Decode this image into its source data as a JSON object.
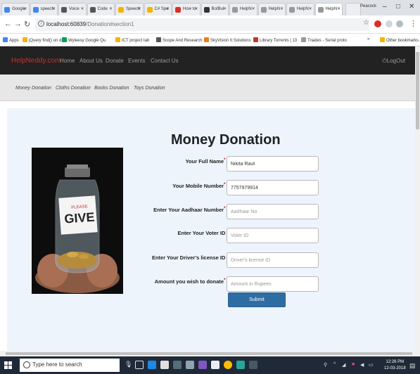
{
  "browser": {
    "tabs": [
      {
        "label": "Google",
        "color": "#4285f4"
      },
      {
        "label": "speech",
        "color": "#4285f4"
      },
      {
        "label": "Voice",
        "color": "#555"
      },
      {
        "label": "Code",
        "color": "#555"
      },
      {
        "label": "Speech",
        "color": "#f4b400"
      },
      {
        "label": "C# Spe",
        "color": "#f4b400"
      },
      {
        "label": "How to",
        "color": "#d93025"
      },
      {
        "label": "BotBui",
        "color": "#333"
      },
      {
        "label": "HelpN",
        "color": "#999"
      },
      {
        "label": "HelpN",
        "color": "#999"
      },
      {
        "label": "HelpN",
        "color": "#999"
      },
      {
        "label": "HelpN",
        "color": "#999"
      }
    ],
    "profile_name": "Peacock",
    "url_host": "localhost:60839",
    "url_path": "/Donation#section1",
    "bookmarks": [
      {
        "label": "Apps",
        "color": "#4285f4"
      },
      {
        "label": "jQuery find() on data",
        "color": "#f4b400"
      },
      {
        "label": "Wyleesy Google Qu",
        "color": "#0f9d58"
      },
      {
        "label": "ICT project tab",
        "color": "#f4b400"
      },
      {
        "label": "Scope And Research",
        "color": "#555"
      },
      {
        "label": "SkyVision It Solutions",
        "color": "#e67e22"
      },
      {
        "label": "Library Torrents | 13",
        "color": "#c0392b"
      },
      {
        "label": "Triades - Serial proto",
        "color": "#999"
      }
    ],
    "other_bookmarks": "Other bookmarks"
  },
  "site": {
    "brand": "HelpNeddy.com",
    "nav": [
      "Home",
      "About Us",
      "Donate",
      "Events",
      "Contact Us"
    ],
    "logout": "LogOut",
    "subnav": [
      "Money Donation",
      "Cloths Donation",
      "Books Donation",
      "Toys Donation"
    ]
  },
  "form": {
    "title": "Money Donation",
    "image_text_top": "PLEASE",
    "image_text_main": "GIVE",
    "fields": [
      {
        "label": "Your Full Name",
        "required": true,
        "value": "Nikita Raut",
        "placeholder": ""
      },
      {
        "label": "Your Mobile Number",
        "required": true,
        "value": "7757979914",
        "placeholder": ""
      },
      {
        "label": "Enter Your Aadhaar Number",
        "required": true,
        "value": "",
        "placeholder": "Aadhaar No"
      },
      {
        "label": "Enter Your Voter ID",
        "required": false,
        "value": "",
        "placeholder": "Voter ID"
      },
      {
        "label": "Enter Your Driver's license ID",
        "required": false,
        "value": "",
        "placeholder": "Driver's license ID"
      },
      {
        "label": "Amount you wish to donate",
        "required": true,
        "value": "",
        "placeholder": "Amount in Rupees"
      }
    ],
    "submit": "Submit"
  },
  "taskbar": {
    "search_placeholder": "Type here to search",
    "time": "12:26 PM",
    "date": "12-03-2018"
  },
  "colors": {
    "navbar_bg": "#222222",
    "brand": "#c9302c",
    "button": "#2e6da4",
    "panel_bg": "#eef4fb"
  }
}
